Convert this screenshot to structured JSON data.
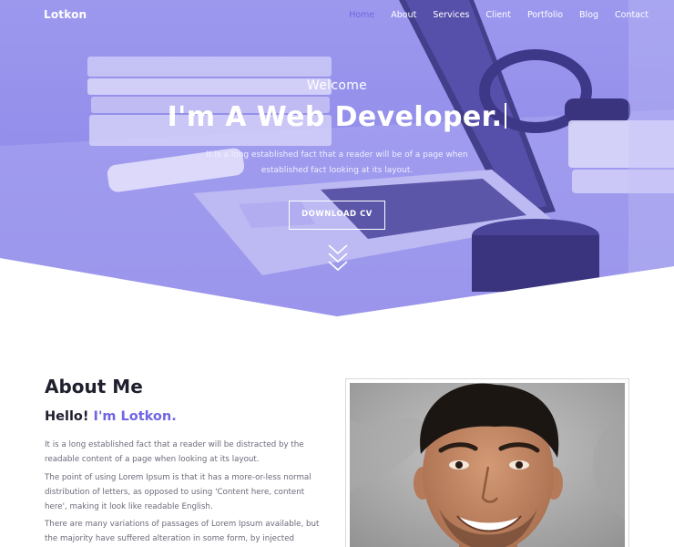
{
  "nav": {
    "brand": "Lotkon",
    "links": [
      "Home",
      "About",
      "Services",
      "Client",
      "Portfolio",
      "Blog",
      "Contact"
    ],
    "active": "Home"
  },
  "hero": {
    "welcome": "Welcome",
    "headline": "I'm A Web Developer.",
    "description": "It is a long established fact that a reader will be of a page when established fact looking at its layout.",
    "button": "DOWNLOAD CV"
  },
  "about": {
    "title_strong": "About",
    "title_rest": " Me",
    "hello": "Hello! ",
    "name": "I'm Lotkon.",
    "paragraphs": [
      "It is a long established fact that a reader will be distracted by the readable content of a page when looking at its layout.",
      "The point of using Lorem Ipsum is that it has a more-or-less normal distribution of letters, as opposed to using 'Content here, content here', making it look like readable English.",
      "There are many variations of passages of Lorem Ipsum available, but the majority have suffered alteration in some form, by injected humour, or"
    ]
  },
  "colors": {
    "accent": "#6f67e0",
    "hero_overlay": "#8b86e8"
  },
  "icons": {
    "scroll": "chevrons-down-icon"
  }
}
